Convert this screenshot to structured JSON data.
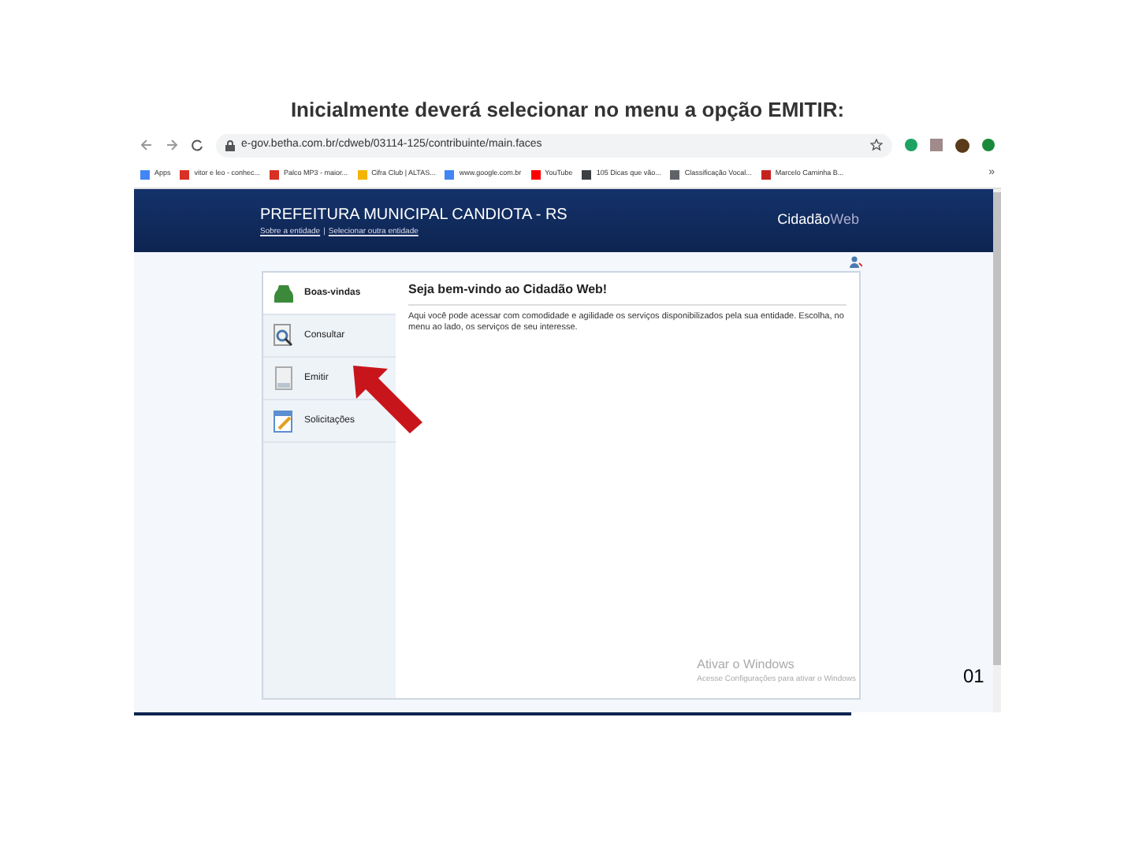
{
  "document": {
    "heading": "Inicialmente deverá selecionar no menu a opção EMITIR:",
    "page_number": "01"
  },
  "browser": {
    "address": "e-gov.betha.com.br/cdweb/03114-125/contribuinte/main.faces",
    "more": "»",
    "bookmarks": [
      {
        "label": "Apps"
      },
      {
        "label": "vitor e leo - conhec..."
      },
      {
        "label": "Palco MP3 - maior..."
      },
      {
        "label": "Cifra Club | ALTAS..."
      },
      {
        "label": "www.google.com.br"
      },
      {
        "label": "YouTube"
      },
      {
        "label": "105 Dicas que vão..."
      },
      {
        "label": "Classificação Vocal..."
      },
      {
        "label": "Marcelo Caminha B..."
      }
    ]
  },
  "site": {
    "title": "PREFEITURA MUNICIPAL CANDIOTA - RS",
    "links": [
      "Sobre a entidade",
      "Selecionar outra entidade"
    ],
    "separator": "|",
    "brand_bold": "Cidadão",
    "brand_light": "Web"
  },
  "menu": [
    {
      "label": "Boas-vindas",
      "selected": true
    },
    {
      "label": "Consultar",
      "selected": false
    },
    {
      "label": "Emitir",
      "selected": false
    },
    {
      "label": "Solicitações",
      "selected": false
    }
  ],
  "content": {
    "title": "Seja bem-vindo ao Cidadão Web!",
    "text": "Aqui você pode acessar com comodidade e agilidade os serviços disponibilizados pela sua entidade. Escolha, no menu ao lado, os serviços de seu interesse."
  },
  "os_notice": {
    "title": "Ativar o Windows",
    "text": "Acesse Configurações para ativar o Windows"
  }
}
